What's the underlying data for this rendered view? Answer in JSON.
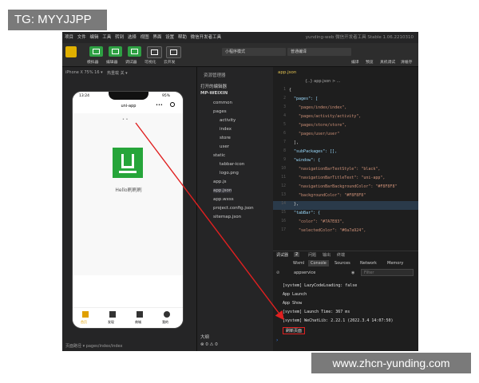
{
  "watermark": {
    "top_left": "TG: MYYJJPP",
    "bottom_right": "www.zhcn-yunding.com"
  },
  "menubar": {
    "items": [
      "项目",
      "文件",
      "编辑",
      "工具",
      "转到",
      "选择",
      "视图",
      "界面",
      "设置",
      "帮助",
      "微信开发者工具"
    ],
    "window_title": "yunding-web 微信开发者工具 Stable 1.06.2210310"
  },
  "toolbar": {
    "buttons": [
      {
        "label": "模拟器"
      },
      {
        "label": "编辑器"
      },
      {
        "label": "调试器"
      },
      {
        "label": "可视化"
      },
      {
        "label": "云开发"
      }
    ],
    "mode_select": "小程序模式",
    "compile_select": "普通编译",
    "right_buttons": [
      "编译",
      "预览",
      "真机调试",
      "清缓存"
    ]
  },
  "simulator": {
    "device": "iPhone X 75% 16 ▾",
    "hot_reload": "热重载 关 ▾",
    "status_time": "13:24",
    "status_battery": "95%",
    "nav_title": "uni-app",
    "hello_text": "Hello刷刷刷",
    "tabs": [
      "首页",
      "发现",
      "商城",
      "我的"
    ]
  },
  "explorer": {
    "title": "资源管理器",
    "open_editors": "打开的编辑器",
    "project": "MP-WEIXIN",
    "items": [
      "common",
      "pages",
      "activity",
      "index",
      "store",
      "user",
      "static",
      "tabbar-icon",
      "logo.png",
      "app.js",
      "app.json",
      "app.wxss",
      "project.config.json",
      "sitemap.json"
    ],
    "outline": "大纲",
    "problems": "⊗ 0 ⚠ 0"
  },
  "editor": {
    "tab": "app.json",
    "breadcrumb": "{..} app.json > ...",
    "lines": [
      "{",
      "  \"pages\": [",
      "    \"pages/index/index\",",
      "    \"pages/activity/activity\",",
      "    \"pages/store/store\",",
      "    \"pages/user/user\"",
      "  ],",
      "  \"subPackages\": [],",
      "  \"window\": {",
      "    \"navigationBarTextStyle\": \"black\",",
      "    \"navigationBarTitleText\": \"uni-app\",",
      "    \"navigationBarBackgroundColor\": \"#F8F8F8\"",
      "    \"backgroundColor\": \"#F8F8F8\"",
      "  },",
      "  \"tabBar\": {",
      "    \"color\": \"#7A7E83\",",
      "    \"selectedColor\": \"#0a7a924\","
    ],
    "line_numbers": [
      "1",
      "2",
      "3",
      "4",
      "5",
      "6",
      "7",
      "8",
      "9",
      "10",
      "11",
      "12",
      "13",
      "14",
      "15",
      "16",
      "17"
    ]
  },
  "console": {
    "top_tabs": [
      "调试器",
      "2",
      "问题",
      "输出",
      "终端"
    ],
    "tabs": [
      "Wxml",
      "Console",
      "Sources",
      "Network",
      "Memory"
    ],
    "context": "appservice",
    "filter_placeholder": "Filter",
    "logs": [
      "[system] LazyCodeLoading: false",
      "App Launch",
      "App Show",
      "[system] Launch Time: 367 ms",
      "[system] WeChatLib: 2.22.1 (2022.3.4 14:07:50)",
      "刷新页面"
    ]
  },
  "statusbar": {
    "path": "页面路径 ▾   pages/index/index"
  },
  "colors": {
    "accent_green": "#2ea043",
    "logo_green": "#26a53a",
    "highlight_red": "#e02020"
  }
}
